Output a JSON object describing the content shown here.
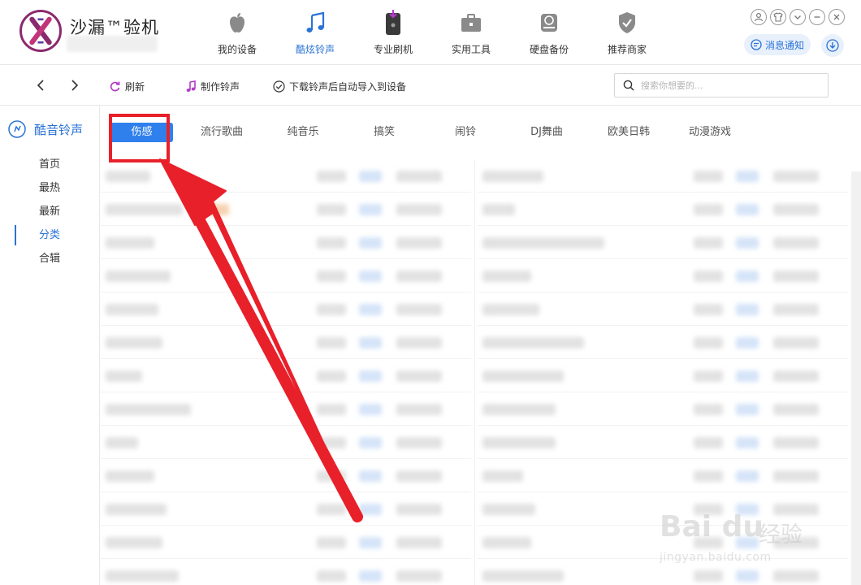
{
  "app": {
    "title": "沙漏™验机"
  },
  "nav": [
    {
      "label": "我的设备",
      "icon": "apple-icon"
    },
    {
      "label": "酷炫铃声",
      "icon": "music-note-icon",
      "active": true
    },
    {
      "label": "专业刷机",
      "icon": "phone-flash-icon"
    },
    {
      "label": "实用工具",
      "icon": "toolbox-icon"
    },
    {
      "label": "硬盘备份",
      "icon": "disk-backup-icon"
    },
    {
      "label": "推荐商家",
      "icon": "shield-check-icon"
    }
  ],
  "header_right": {
    "notify_label": "消息通知"
  },
  "toolbar": {
    "refresh_label": "刷新",
    "make_ringtone_label": "制作铃声",
    "auto_import_label": "下载铃声后自动导入到设备",
    "search_placeholder": "搜索你想要的..."
  },
  "sidebar": {
    "title": "酷音铃声",
    "items": [
      {
        "label": "首页"
      },
      {
        "label": "最热"
      },
      {
        "label": "最新"
      },
      {
        "label": "分类",
        "active": true
      },
      {
        "label": "合辑"
      }
    ]
  },
  "tabs": [
    {
      "label": "伤感",
      "active": true
    },
    {
      "label": "流行歌曲"
    },
    {
      "label": "纯音乐"
    },
    {
      "label": "搞笑"
    },
    {
      "label": "闹铃"
    },
    {
      "label": "DJ舞曲"
    },
    {
      "label": "欧美日韩"
    },
    {
      "label": "动漫游戏"
    }
  ],
  "colors": {
    "accent": "#2b73d6",
    "tab_active": "#2f80ed",
    "annotation_red": "#e8202a"
  },
  "watermark": {
    "logo_text": "Bai du",
    "brand_cn": "经验",
    "url": "jingyan.baidu.com"
  }
}
